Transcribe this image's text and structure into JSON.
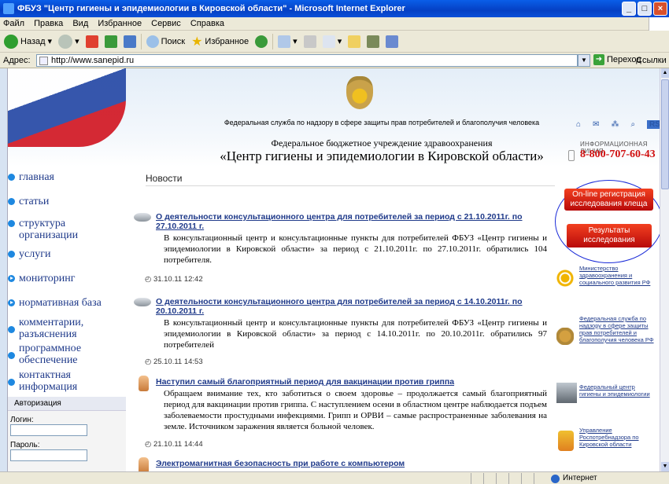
{
  "window": {
    "title": "ФБУЗ \"Центр гигиены и эпидемиологии в Кировской области\" - Microsoft Internet Explorer",
    "min": "_",
    "max": "□",
    "close": "×"
  },
  "menu": [
    "Файл",
    "Правка",
    "Вид",
    "Избранное",
    "Сервис",
    "Справка"
  ],
  "toolbar": {
    "back": "Назад",
    "search": "Поиск",
    "favorites": "Избранное"
  },
  "address": {
    "label": "Адрес:",
    "url": "http://www.sanepid.ru",
    "go": "Переход",
    "links": "Ссылки"
  },
  "header": {
    "federal": "Федеральная служба по надзору в сфере защиты прав потребителей и благополучия человека",
    "fbu": "Федеральное бюджетное учреждение здравоохранения",
    "org": "«Центр гигиены и эпидемиологии в Кировской области»",
    "rss": "RSS",
    "info_line": "ИНФОРМАЦИОННАЯ ЛИНИЯ",
    "phone": "8-800-707-60-43"
  },
  "nav": [
    {
      "l1": "главная",
      "l2": ""
    },
    {
      "l1": "статьи",
      "l2": ""
    },
    {
      "l1": "структура",
      "l2": "организации"
    },
    {
      "l1": "услуги",
      "l2": ""
    },
    {
      "l1": "мониторинг",
      "l2": ""
    },
    {
      "l1": "нормативная база",
      "l2": ""
    },
    {
      "l1": "комментарии,",
      "l2": "разъяснения"
    },
    {
      "l1": "программное",
      "l2": "обеспечение"
    },
    {
      "l1": "контактная",
      "l2": "информация"
    }
  ],
  "auth": {
    "title": "Авторизация",
    "login": "Логин:",
    "password": "Пароль:"
  },
  "news": {
    "heading": "Новости",
    "items": [
      {
        "title": "О деятельности консультационного центра для потребителей за период с 21.10.2011г. по 27.10.2011 г.",
        "text1": "В консультационный центр и консультационные пункты для потребителей ФБУЗ «Центр гигиены и эпидемиологии в Кировской области» за период с 21.10.2011г. по 27.10.2011г. обратились 104 потребителя.",
        "date": "31.10.11 12:42"
      },
      {
        "title": "О деятельности консультационного центра для потребителей за период с 14.10.2011г. по 20.10.2011 г.",
        "text1": "В консультационный центр и консультационные пункты для потребителей ФБУЗ «Центр гигиены и эпидемиологии в Кировской области» за период с 14.10.2011г. по 20.10.2011г. обратились 97 потребителей",
        "date": "25.10.11 14:53"
      },
      {
        "title": "Наступил самый благоприятный период для вакцинации против гриппа",
        "text1": "Обращаем внимание тех, кто заботиться о своем здоровье – продолжается самый благоприятный период для вакцинации против гриппа. С наступлением осени в областном центре наблюдается подъем заболеваемости простудными инфекциями. Грипп и ОРВИ – самые распространенные заболевания на земле. Источником заражения является больной человек.",
        "date": "21.10.11 14:44"
      },
      {
        "title": "Электромагнитная безопасность при работе с компьютером",
        "text1": "",
        "date": ""
      }
    ]
  },
  "right": {
    "online": "On-line регистрация исследования клеща",
    "results": "Результаты исследования",
    "links": [
      "Министерство здравоохранения и социального развития РФ",
      "Федеральная служба по надзору в сфере защиты прав потребителей и благополучия человека РФ",
      "Федеральный центр гигиены и эпидемиологии",
      "Управление Роспотребнадзора по Кировской области"
    ]
  },
  "status": {
    "zone": "Интернет"
  }
}
